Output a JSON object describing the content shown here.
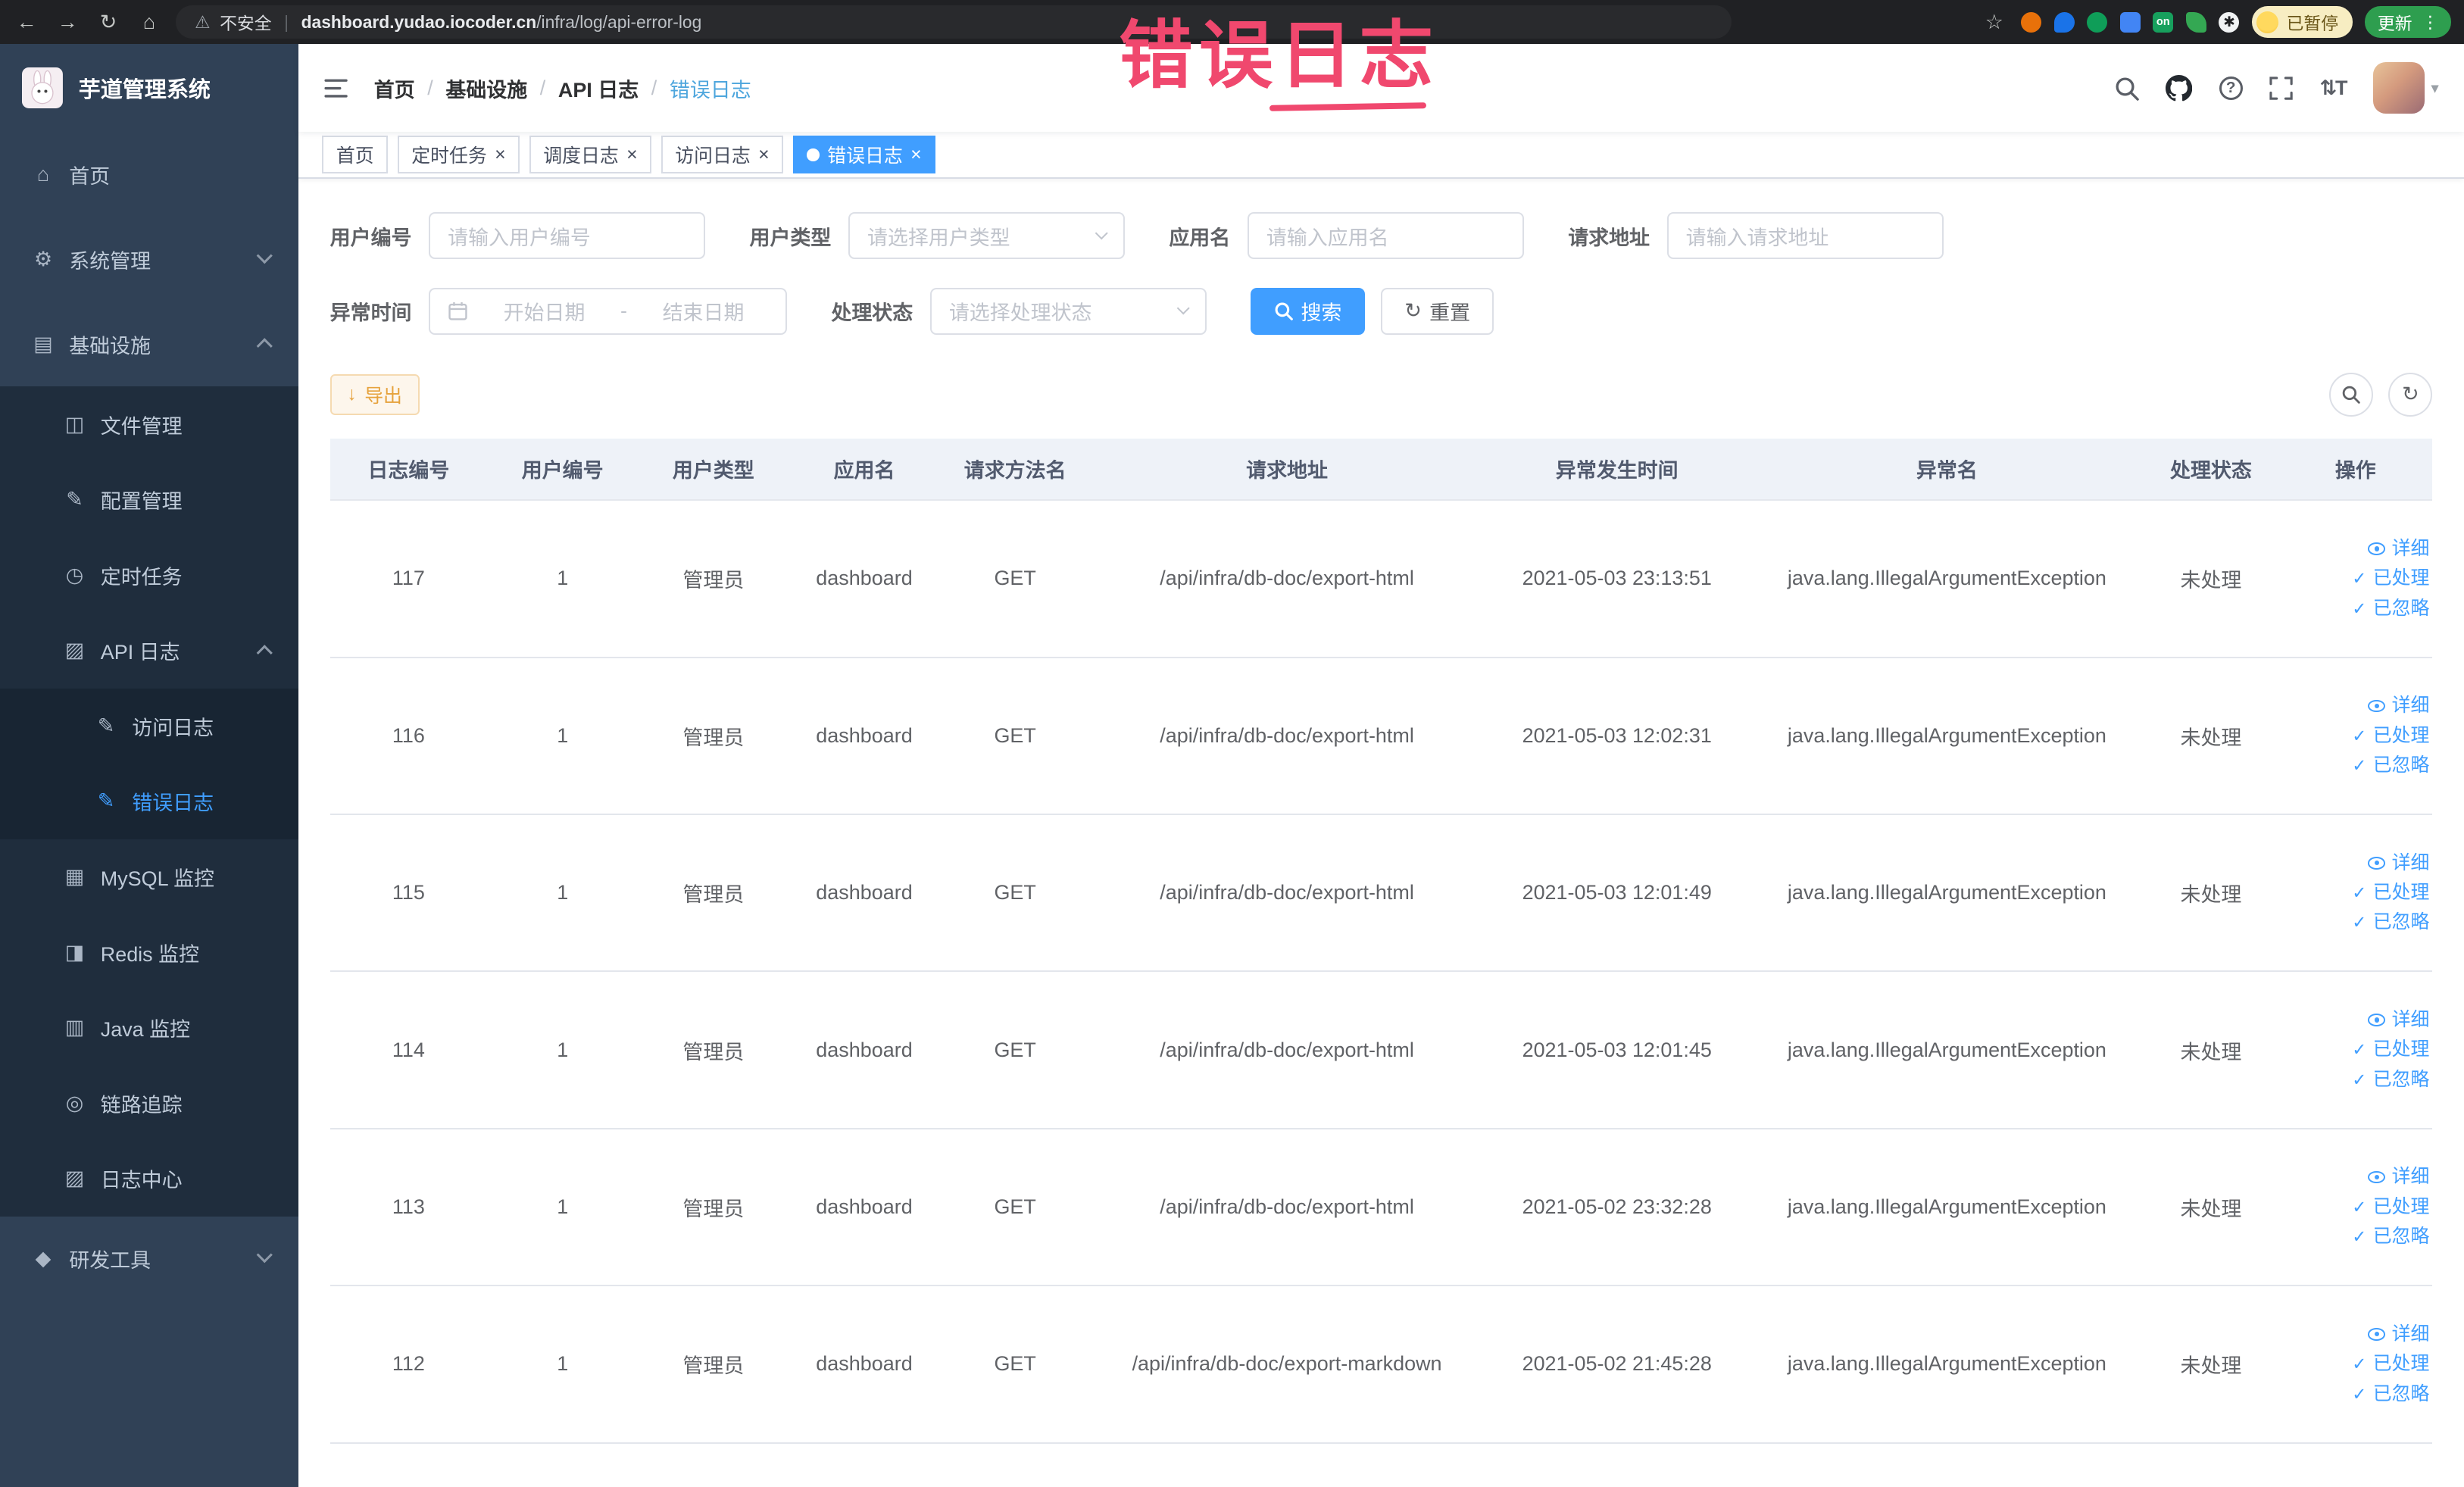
{
  "browser": {
    "security_label": "不安全",
    "url_host": "dashboard.yudao.iocoder.cn",
    "url_path": "/infra/log/api-error-log",
    "profile_badge": "已暂停",
    "update_button": "更新"
  },
  "annotation": {
    "text": "错误日志"
  },
  "icons": {
    "back": "←",
    "forward": "→",
    "reload": "↻",
    "home": "⌂",
    "warning": "⚠",
    "divider": "|",
    "star": "☆",
    "menu_dots": "⋮",
    "caret_down": "▾",
    "question": "?",
    "font_size": "⇅T",
    "close": "×",
    "check": "✓",
    "download": "↓",
    "refresh": "↻",
    "ext_on": "on",
    "ext_paw": "✱"
  },
  "sidebar": {
    "title": "芋道管理系统",
    "menu": [
      {
        "label": "首页",
        "glyph": "⌂"
      },
      {
        "label": "系统管理",
        "glyph": "⚙"
      },
      {
        "label": "基础设施",
        "glyph": "▤"
      },
      {
        "label": "文件管理",
        "glyph": "◫"
      },
      {
        "label": "配置管理",
        "glyph": "✎"
      },
      {
        "label": "定时任务",
        "glyph": "◷"
      },
      {
        "label": "API 日志",
        "glyph": "▨"
      },
      {
        "label": "访问日志",
        "glyph": "✎"
      },
      {
        "label": "错误日志",
        "glyph": "✎"
      },
      {
        "label": "MySQL 监控",
        "glyph": "▦"
      },
      {
        "label": "Redis 监控",
        "glyph": "◨"
      },
      {
        "label": "Java 监控",
        "glyph": "▥"
      },
      {
        "label": "链路追踪",
        "glyph": "◎"
      },
      {
        "label": "日志中心",
        "glyph": "▨"
      },
      {
        "label": "研发工具",
        "glyph": "◆"
      }
    ]
  },
  "breadcrumb": [
    "首页",
    "基础设施",
    "API 日志",
    "错误日志"
  ],
  "tabs": [
    {
      "label": "首页"
    },
    {
      "label": "定时任务"
    },
    {
      "label": "调度日志"
    },
    {
      "label": "访问日志"
    },
    {
      "label": "错误日志"
    }
  ],
  "filters": {
    "user_id": {
      "label": "用户编号",
      "placeholder": "请输入用户编号"
    },
    "user_type": {
      "label": "用户类型",
      "placeholder": "请选择用户类型"
    },
    "app_name": {
      "label": "应用名",
      "placeholder": "请输入应用名"
    },
    "request_url": {
      "label": "请求地址",
      "placeholder": "请输入请求地址"
    },
    "exception_time": {
      "label": "异常时间",
      "start_placeholder": "开始日期",
      "separator": "-",
      "end_placeholder": "结束日期"
    },
    "process_status": {
      "label": "处理状态",
      "placeholder": "请选择处理状态"
    },
    "search_button": "搜索",
    "reset_button": "重置"
  },
  "toolbar": {
    "export_button": "导出"
  },
  "table": {
    "columns": [
      "日志编号",
      "用户编号",
      "用户类型",
      "应用名",
      "请求方法名",
      "请求地址",
      "异常发生时间",
      "异常名",
      "处理状态",
      "操作"
    ],
    "actions": [
      "详细",
      "已处理",
      "已忽略"
    ],
    "rows": [
      {
        "id": "117",
        "user_id": "1",
        "user_type": "管理员",
        "app": "dashboard",
        "method": "GET",
        "url": "/api/infra/db-doc/export-html",
        "time": "2021-05-03 23:13:51",
        "exception": "java.lang.IllegalArgumentException",
        "status": "未处理"
      },
      {
        "id": "116",
        "user_id": "1",
        "user_type": "管理员",
        "app": "dashboard",
        "method": "GET",
        "url": "/api/infra/db-doc/export-html",
        "time": "2021-05-03 12:02:31",
        "exception": "java.lang.IllegalArgumentException",
        "status": "未处理"
      },
      {
        "id": "115",
        "user_id": "1",
        "user_type": "管理员",
        "app": "dashboard",
        "method": "GET",
        "url": "/api/infra/db-doc/export-html",
        "time": "2021-05-03 12:01:49",
        "exception": "java.lang.IllegalArgumentException",
        "status": "未处理"
      },
      {
        "id": "114",
        "user_id": "1",
        "user_type": "管理员",
        "app": "dashboard",
        "method": "GET",
        "url": "/api/infra/db-doc/export-html",
        "time": "2021-05-03 12:01:45",
        "exception": "java.lang.IllegalArgumentException",
        "status": "未处理"
      },
      {
        "id": "113",
        "user_id": "1",
        "user_type": "管理员",
        "app": "dashboard",
        "method": "GET",
        "url": "/api/infra/db-doc/export-html",
        "time": "2021-05-02 23:32:28",
        "exception": "java.lang.IllegalArgumentException",
        "status": "未处理"
      },
      {
        "id": "112",
        "user_id": "1",
        "user_type": "管理员",
        "app": "dashboard",
        "method": "GET",
        "url": "/api/infra/db-doc/export-markdown",
        "time": "2021-05-02 21:45:28",
        "exception": "java.lang.IllegalArgumentException",
        "status": "未处理"
      }
    ]
  },
  "colors": {
    "accent": "#409eff",
    "warning": "#e6a23c",
    "annotation": "#f0486e",
    "sidebar_bg": "#304156",
    "active_tab_bg": "#409eff",
    "update_chip": "#2e9e4f"
  }
}
